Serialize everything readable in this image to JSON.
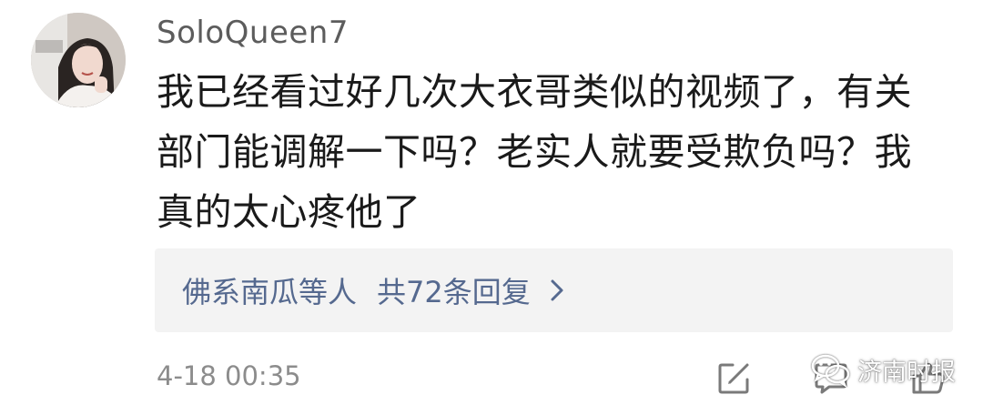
{
  "comment": {
    "username": "SoloQueen7",
    "text": "我已经看过好几次大衣哥类似的视频了，有关部门能调解一下吗？老实人就要受欺负吗？我真的太心疼他了",
    "replies": {
      "names": "佛系南瓜",
      "etc": "等人",
      "count": "共72条回复"
    },
    "timestamp": "4-18 00:35"
  },
  "icons": {
    "avatar": "avatar",
    "reply_chevron": "chevron-right-icon",
    "edit": "edit-icon",
    "comment": "comment-icon",
    "like": "thumbs-up-icon"
  },
  "watermark": {
    "text": "济南时报"
  },
  "colors": {
    "link": "#55698f",
    "text": "#1a1a1a",
    "muted": "#8c8c8c",
    "reply_bg": "#f3f3f3"
  }
}
